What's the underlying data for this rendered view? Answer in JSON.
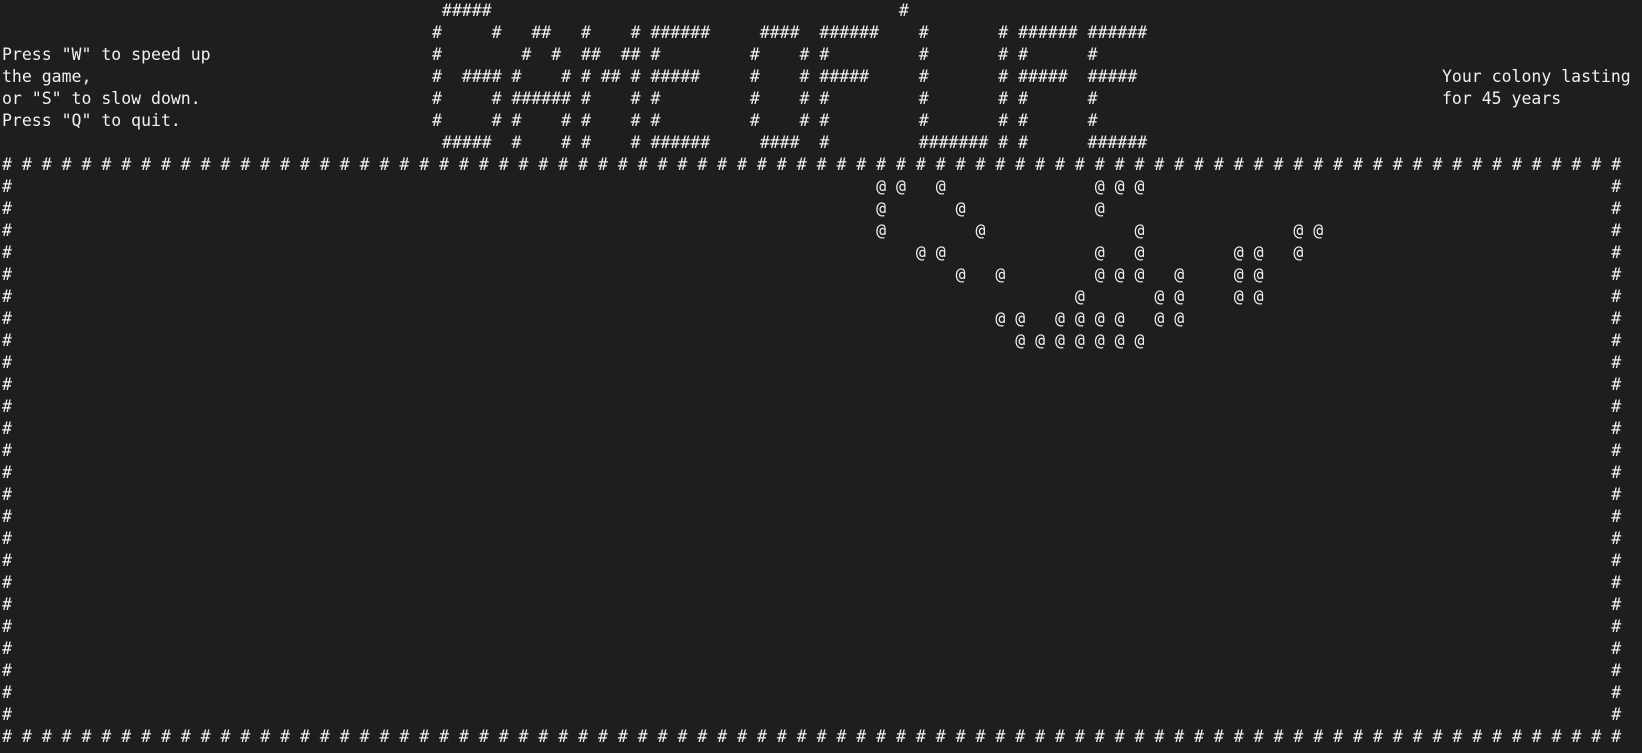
{
  "help": {
    "line1": "Press \"W\" to speed up",
    "line2": "the game,",
    "line3": "or \"S\" to slow down.",
    "line4": "Press \"Q\" to quit."
  },
  "status": {
    "line1": "Your colony lasting",
    "line2": "for 45 years"
  },
  "title_art": " #####                                         #\n#     #   ##   #    # ######     ####  ######    #       # ###### ######\n#        #  #  ##  ## #         #    # #         #       # #      #\n#  #### #    # # ## # #####     #    # #####     #       # #####  #####\n#     # ###### #    # #         #    # #         #       # #      #\n#     # #    # #    # #         #    # #         #       # #      #\n #####  #    # #    # ######     ####  #         ####### # #      ######",
  "board": {
    "border_char": "#",
    "cell_char": "@",
    "width": 82,
    "height": 27,
    "live_cells": [
      [
        1,
        44
      ],
      [
        1,
        45
      ],
      [
        1,
        47
      ],
      [
        1,
        55
      ],
      [
        1,
        56
      ],
      [
        1,
        57
      ],
      [
        2,
        44
      ],
      [
        2,
        48
      ],
      [
        2,
        55
      ],
      [
        3,
        44
      ],
      [
        3,
        49
      ],
      [
        3,
        57
      ],
      [
        3,
        65
      ],
      [
        3,
        66
      ],
      [
        4,
        46
      ],
      [
        4,
        47
      ],
      [
        4,
        55
      ],
      [
        4,
        57
      ],
      [
        4,
        62
      ],
      [
        4,
        63
      ],
      [
        4,
        65
      ],
      [
        5,
        48
      ],
      [
        5,
        50
      ],
      [
        5,
        55
      ],
      [
        5,
        56
      ],
      [
        5,
        57
      ],
      [
        5,
        59
      ],
      [
        5,
        62
      ],
      [
        5,
        63
      ],
      [
        6,
        54
      ],
      [
        6,
        58
      ],
      [
        6,
        59
      ],
      [
        6,
        62
      ],
      [
        6,
        63
      ],
      [
        7,
        50
      ],
      [
        7,
        51
      ],
      [
        7,
        53
      ],
      [
        7,
        54
      ],
      [
        7,
        55
      ],
      [
        7,
        56
      ],
      [
        7,
        58
      ],
      [
        7,
        59
      ],
      [
        8,
        51
      ],
      [
        8,
        52
      ],
      [
        8,
        53
      ],
      [
        8,
        54
      ],
      [
        8,
        55
      ],
      [
        8,
        56
      ],
      [
        8,
        57
      ]
    ]
  }
}
